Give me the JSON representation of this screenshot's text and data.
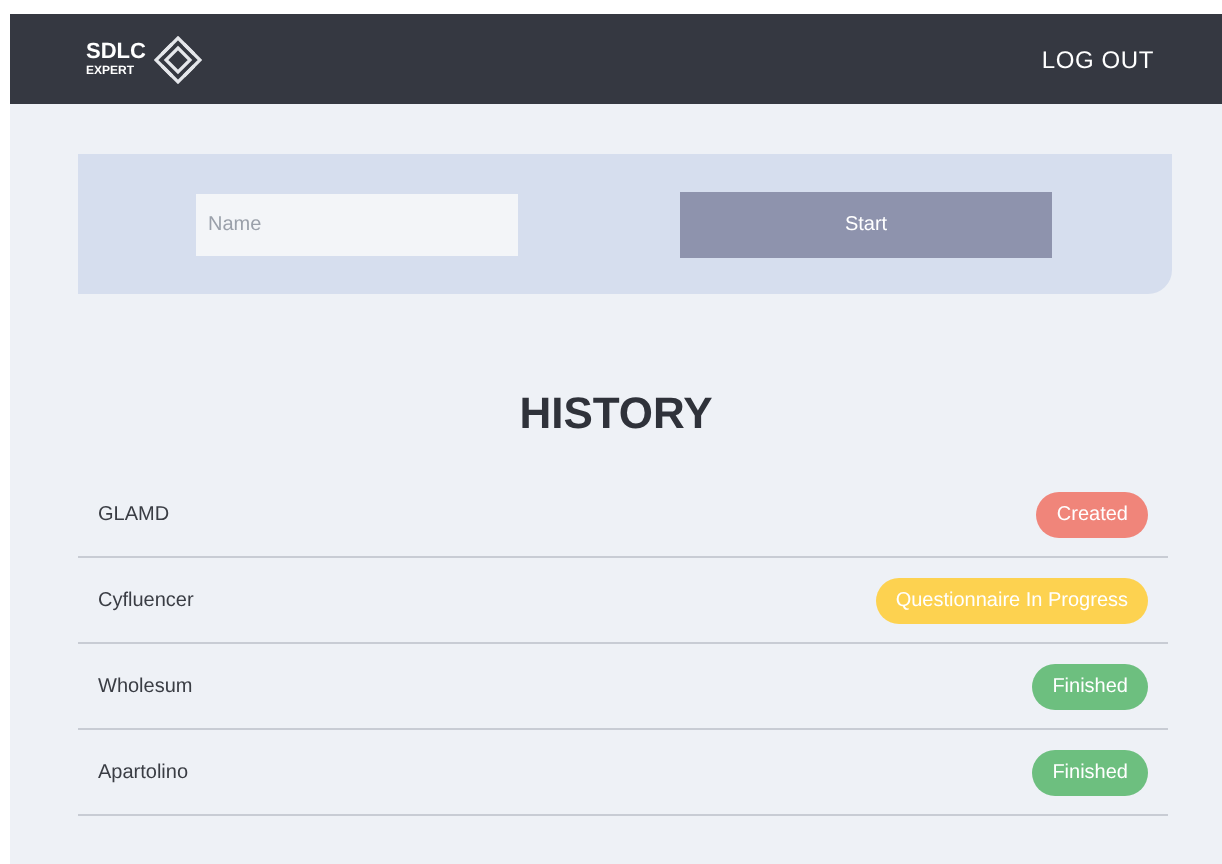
{
  "header": {
    "logo_title": "SDLC",
    "logo_subtitle": "EXPERT",
    "logout": "LOG OUT"
  },
  "form": {
    "name_field": {
      "placeholder": "Name"
    },
    "start_button": "Start"
  },
  "history": {
    "title": "HISTORY",
    "rows": [
      {
        "name": "GLAMD",
        "status": "Created",
        "color": "#f0857a"
      },
      {
        "name": "Cyfluencer",
        "status": "Questionnaire In Progress",
        "color": "#fdd250"
      },
      {
        "name": "Wholesum",
        "status": "Finished",
        "color": "#6dbf7f"
      },
      {
        "name": "Apartolino",
        "status": "Finished",
        "color": "#6dbf7f"
      }
    ]
  }
}
